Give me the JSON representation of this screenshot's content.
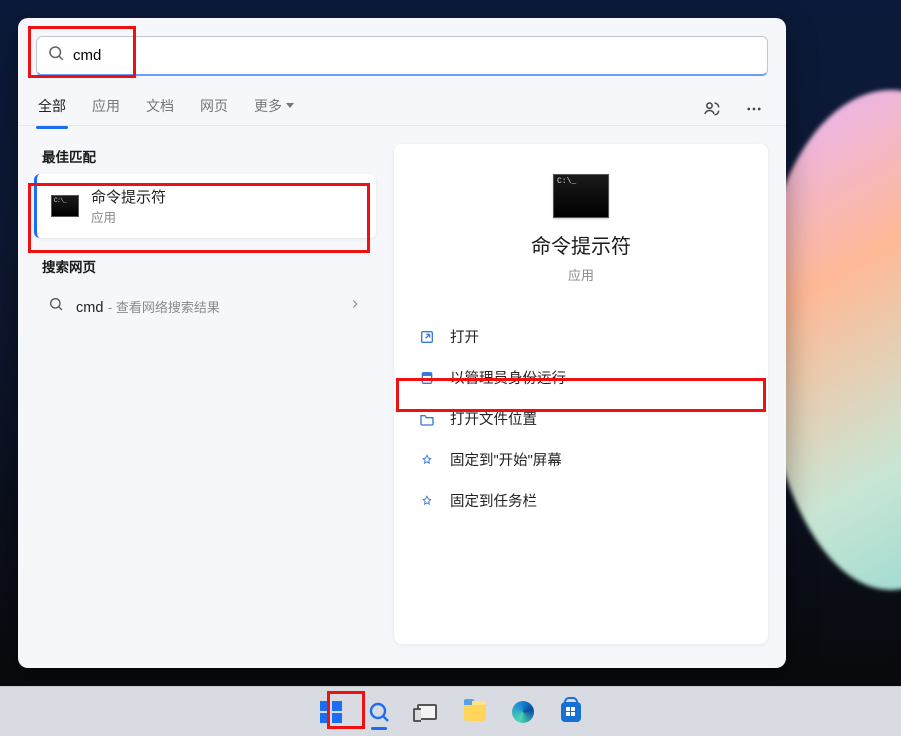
{
  "search": {
    "query": "cmd"
  },
  "tabs": {
    "all": "全部",
    "apps": "应用",
    "docs": "文档",
    "web": "网页",
    "more": "更多"
  },
  "sections": {
    "best_match": "最佳匹配",
    "search_web": "搜索网页"
  },
  "best_match": {
    "title": "命令提示符",
    "subtitle": "应用"
  },
  "web_result": {
    "term": "cmd",
    "hint": "查看网络搜索结果"
  },
  "detail": {
    "title": "命令提示符",
    "subtitle": "应用",
    "actions": {
      "open": "打开",
      "run_admin": "以管理员身份运行",
      "open_location": "打开文件位置",
      "pin_start": "固定到\"开始\"屏幕",
      "pin_taskbar": "固定到任务栏"
    }
  },
  "taskbar": {
    "start": "Start",
    "search": "Search",
    "taskview": "Task View",
    "explorer": "File Explorer",
    "edge": "Microsoft Edge",
    "store": "Microsoft Store"
  }
}
